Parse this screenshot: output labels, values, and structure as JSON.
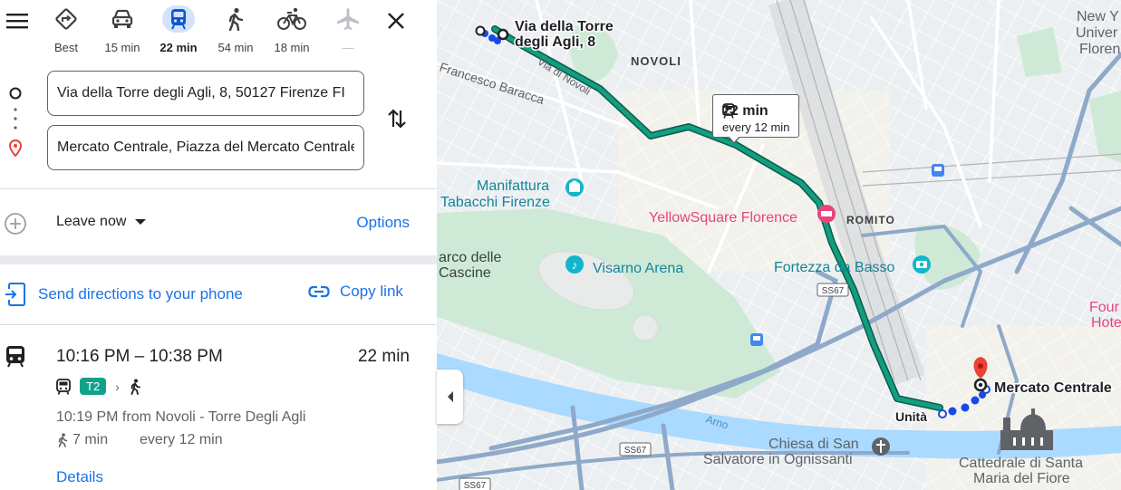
{
  "modes": [
    {
      "name": "best",
      "label": "Best",
      "icon": "directions-diamond-icon"
    },
    {
      "name": "driving",
      "label": "15 min",
      "icon": "car-icon"
    },
    {
      "name": "transit",
      "label": "22 min",
      "icon": "tram-icon",
      "active": true
    },
    {
      "name": "walking",
      "label": "54 min",
      "icon": "walking-icon"
    },
    {
      "name": "cycling",
      "label": "18 min",
      "icon": "bicycle-icon"
    },
    {
      "name": "flight",
      "label": "—",
      "icon": "airplane-icon"
    }
  ],
  "origin": {
    "value": "Via della Torre degli Agli, 8, 50127 Firenze FI"
  },
  "destination": {
    "value": "Mercato Centrale, Piazza del Mercato Centrale"
  },
  "leave": {
    "label": "Leave now",
    "options": "Options"
  },
  "actions": {
    "send": "Send directions to your phone",
    "copy": "Copy link"
  },
  "route": {
    "time_range": "10:16 PM – 10:38 PM",
    "duration": "22 min",
    "line": "T2",
    "departure": "10:19 PM from Novoli - Torre Degli Agli",
    "walk": "7 min",
    "frequency": "every 12 min",
    "details": "Details"
  },
  "callout": {
    "duration": "22 min",
    "frequency": "every 12 min"
  },
  "map_labels": {
    "origin": [
      "Via della Torre",
      "degli Agli, 8"
    ],
    "novoli": "NOVOLI",
    "via_di_novoli": "Via di Novoli",
    "francesco_baracca": "Francesco Baracca",
    "manifattura": [
      "Manifattura",
      "Tabacchi Firenze"
    ],
    "yellowsquare": "YellowSquare Florence",
    "romito": "ROMITO",
    "parco_cascine": [
      "arco delle",
      "Cascine"
    ],
    "visarno": "Visarno Arena",
    "fortezza": "Fortezza da Basso",
    "ss67": "SS67",
    "mercato": "Mercato Centrale",
    "unita": "Unità",
    "arno": "Arno",
    "chiesa": [
      "Chiesa di San",
      "Salvatore in Ognissanti"
    ],
    "cattedrale": [
      "Cattedrale di Santa",
      "Maria del Fiore"
    ],
    "new_york": [
      "New Y",
      "Univer",
      "Floren"
    ],
    "four": [
      "Four",
      "Hote"
    ]
  },
  "colors": {
    "accent": "#1a73e8",
    "tram_line": "#129e7f",
    "walk_dots": "#1a47e8",
    "pin": "#ea4335",
    "park": "#ceead6",
    "water": "#aadaff"
  }
}
